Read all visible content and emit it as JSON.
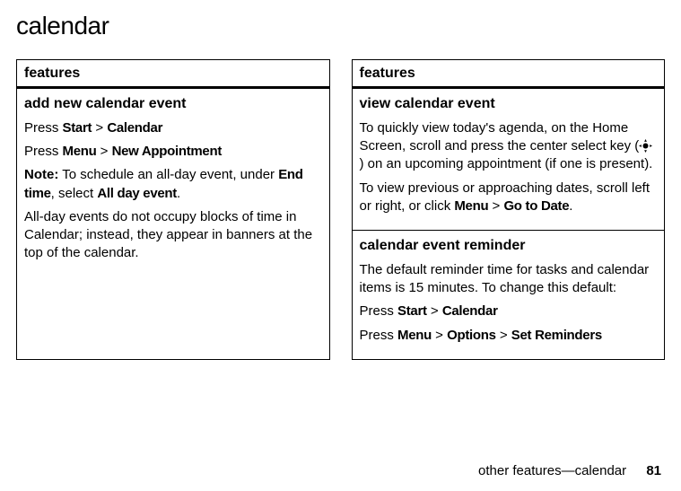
{
  "title": "calendar",
  "left": {
    "heading": "features",
    "section1": {
      "title": "add new calendar event",
      "p1_a": "Press ",
      "p1_b": "Start",
      "p1_c": " > ",
      "p1_d": "Calendar",
      "p2_a": "Press ",
      "p2_b": "Menu",
      "p2_c": " > ",
      "p2_d": "New Appointment",
      "p3_a": "Note:",
      "p3_b": " To schedule an all-day event, under ",
      "p3_c": "End time",
      "p3_d": ", select ",
      "p3_e": "All day event",
      "p3_f": ".",
      "p4": "All-day events do not occupy blocks of time in Calendar; instead, they appear in banners at the top of the calendar."
    }
  },
  "right": {
    "heading": "features",
    "section1": {
      "title": "view calendar event",
      "p1_a": "To quickly view today's agenda, on the Home Screen, scroll and press the center select key (",
      "p1_b": ") on an upcoming appointment (if one is present).",
      "p2_a": "To view previous or approaching dates, scroll left or right, or click ",
      "p2_b": "Menu",
      "p2_c": " > ",
      "p2_d": "Go to Date",
      "p2_e": "."
    },
    "section2": {
      "title": "calendar event reminder",
      "p1": "The default reminder time for tasks and calendar items is 15 minutes. To change this default:",
      "p2_a": "Press ",
      "p2_b": "Start",
      "p2_c": " > ",
      "p2_d": "Calendar",
      "p3_a": "Press ",
      "p3_b": "Menu",
      "p3_c": " > ",
      "p3_d": "Options",
      "p3_e": " > ",
      "p3_f": "Set Reminders"
    }
  },
  "footer": {
    "text": "other features—calendar",
    "page": "81"
  }
}
